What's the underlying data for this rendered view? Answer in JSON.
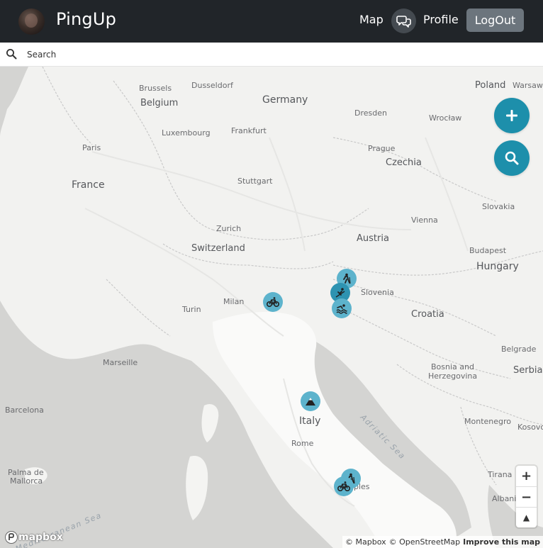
{
  "app": {
    "brand": "PingUp"
  },
  "nav": {
    "map_label": "Map",
    "profile_label": "Profile",
    "logout_label": "LogOut"
  },
  "search": {
    "placeholder": "Search"
  },
  "map": {
    "countries": [
      "Poland",
      "Belgium",
      "Germany",
      "Czechia",
      "France",
      "Slovakia",
      "Switzerland",
      "Austria",
      "Hungary",
      "Slovenia",
      "Croatia",
      "Bosnia and",
      "Herzegovina",
      "Serbia",
      "Italy",
      "Montenegro",
      "Kosovo",
      "Albania"
    ],
    "cities": [
      "Warsaw",
      "Brussels",
      "Dusseldorf",
      "Dresden",
      "Wrocław",
      "Luxembourg",
      "Frankfurt",
      "Paris",
      "Prague",
      "Stuttgart",
      "Vienna",
      "Zurich",
      "Budapest",
      "Milan",
      "Turin",
      "Belgrade",
      "Marseille",
      "Barcelona",
      "Rome",
      "Tirana",
      "Palma de",
      "Mallorca",
      "Naples"
    ],
    "seas": [
      "Adriatic Sea",
      "Mediterranean Sea"
    ],
    "fabs": [
      {
        "label": "add-icon"
      },
      {
        "label": "search-icon"
      }
    ],
    "markers": [
      {
        "activity": "hiking",
        "icon": "hiking-icon"
      },
      {
        "activity": "skiing",
        "icon": "skiing-icon"
      },
      {
        "activity": "swimming",
        "icon": "swimming-icon"
      },
      {
        "activity": "cycling",
        "icon": "bicycle-icon"
      },
      {
        "activity": "climbing",
        "icon": "mountain-icon"
      },
      {
        "activity": "hiking",
        "icon": "hiking-icon"
      },
      {
        "activity": "cycling",
        "icon": "bicycle-icon"
      }
    ],
    "zoom": {
      "in": "+",
      "out": "−",
      "compass": "▲"
    }
  },
  "footer": {
    "logo": "mapbox",
    "attrib_mapbox": "© Mapbox",
    "attrib_osm": "© OpenStreetMap",
    "improve": "Improve this map"
  },
  "colors": {
    "navbar": "#212529",
    "accent": "#1d8fab",
    "marker": "#5db3cc",
    "logout": "#6c757d"
  }
}
